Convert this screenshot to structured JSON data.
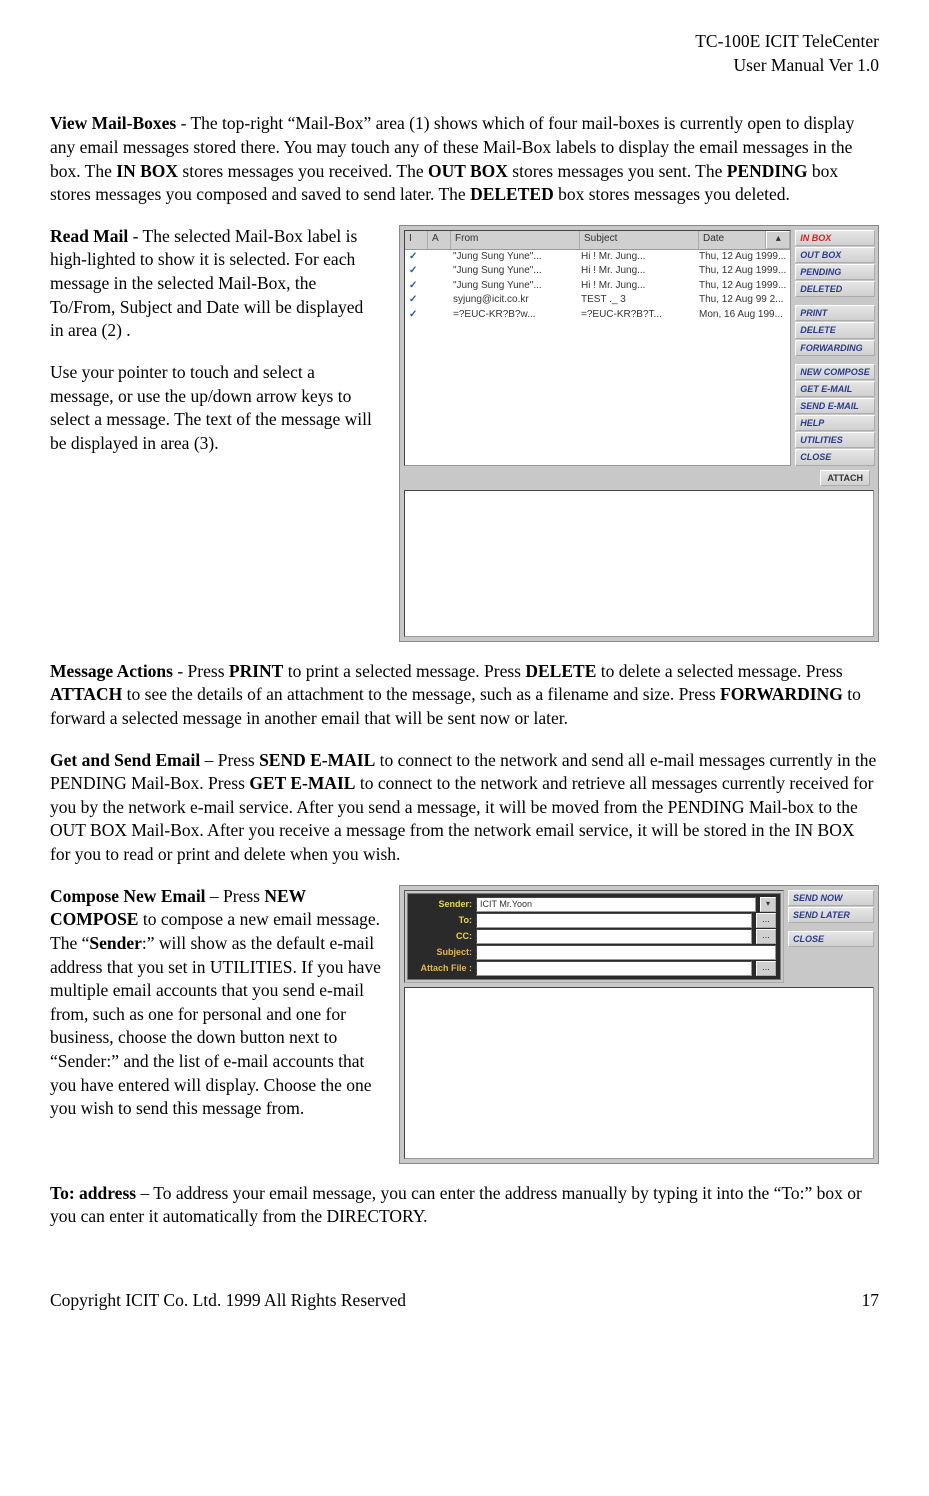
{
  "header": {
    "line1": "TC-100E ICIT TeleCenter",
    "line2": "User Manual  Ver 1.0"
  },
  "para_viewmail": {
    "lead_bold": "View Mail-Boxes ",
    "t1": "- The top-right “Mail-Box” area (1) shows which of four mail-boxes is currently open to display any email messages stored there. You may touch any of these Mail-Box labels to display the email messages in the box. The ",
    "b1": "IN BOX",
    "t2": " stores messages you received. The ",
    "b2": "OUT BOX",
    "t3": " stores messages you sent. The ",
    "b3": "PENDING",
    "t4": " box stores messages you composed and saved to send later. The ",
    "b4": "DELETED",
    "t5": " box stores messages you deleted."
  },
  "para_readmail": {
    "lead_bold": "Read Mail ",
    "t1": "- The selected Mail-Box label is high-lighted to show it is selected. For each message in the selected Mail-Box, the To/From, Subject and Date will be displayed in area (2) ."
  },
  "para_readmail2": "Use your pointer to touch and select a message, or use the up/down arrow keys to select a message. The text of the message will be displayed in area (3).",
  "para_actions": {
    "lead_bold": "Message Actions ",
    "t1": "- Press ",
    "b1": "PRINT",
    "t2": " to print a selected message. Press ",
    "b2": "DELETE",
    "t3": " to delete a selected message. Press ",
    "b3": "ATTACH",
    "t4": " to see the details of an attachment to the message, such as a filename and size. Press ",
    "b4": "FORWARDING",
    "t5": " to forward a selected message in another email that will be sent now or later."
  },
  "para_getsend": {
    "lead_bold": "Get and Send Email ",
    "t1": "– Press ",
    "b1": "SEND E-MAIL",
    "t2": " to connect to the network and send all e-mail messages currently in the PENDING Mail-Box. Press ",
    "b2": "GET E-MAIL",
    "t3": " to connect to the network and retrieve all messages currently received for you by the network e-mail service.  After you send a message, it will be moved from the PENDING Mail-box to the OUT BOX Mail-Box. After you receive a message from the network email service, it will be stored in the IN BOX for you to read or print and delete when you wish."
  },
  "para_compose": {
    "lead_bold": "Compose New Email",
    "dash": " –  Press ",
    "b1": "NEW COMPOSE ",
    "t1": "to compose a new email message.  The “",
    "b2": "Sender",
    "t2": ":” will show as the default e-mail address that you set in UTILITIES. If you have multiple email accounts that you send e-mail from, such as one for personal and one for business, choose the down button next to “Sender:” and the list of e-mail accounts that you have entered will display. Choose the one you wish to send this message from."
  },
  "para_to": {
    "lead_bold": "To:  address",
    "dash": " – ",
    "t1": "To address your email message, you can enter the address manually by typing it into the “To:”  box or you can enter it automatically from the DIRECTORY."
  },
  "footer": {
    "left": "Copyright ICIT Co. Ltd. 1999  All Rights Reserved",
    "right": "17"
  },
  "shot1": {
    "cols": {
      "i": "I",
      "a": "A",
      "from": "From",
      "subject": "Subject",
      "date": "Date"
    },
    "rows": [
      {
        "from": "\"Jung Sung Yune\"...",
        "subj": "Hi ! Mr. Jung...",
        "date": "Thu, 12 Aug 1999..."
      },
      {
        "from": "\"Jung Sung Yune\"...",
        "subj": "Hi ! Mr. Jung...",
        "date": "Thu, 12 Aug 1999..."
      },
      {
        "from": "\"Jung Sung Yune\"...",
        "subj": "Hi ! Mr. Jung...",
        "date": "Thu, 12 Aug 1999..."
      },
      {
        "from": "syjung@icit.co.kr",
        "subj": "TEST ._ 3",
        "date": "Thu, 12 Aug 99 2..."
      },
      {
        "from": "=?EUC-KR?B?w...",
        "subj": "=?EUC-KR?B?T...",
        "date": "Mon, 16 Aug 199..."
      }
    ],
    "attach_btn": "ATTACH",
    "sidebar": {
      "boxes": [
        "IN BOX",
        "OUT BOX",
        "PENDING",
        "DELETED"
      ],
      "group2": [
        "PRINT",
        "DELETE",
        "FORWARDING"
      ],
      "group3": [
        "NEW COMPOSE",
        "GET E-MAIL",
        "SEND E-MAIL",
        "HELP",
        "UTILITIES",
        "CLOSE"
      ]
    }
  },
  "shot2": {
    "labels": {
      "sender": "Sender:",
      "to": "To:",
      "cc": "CC:",
      "subject": "Subject:",
      "attach": "Attach File :"
    },
    "sender_value": "ICIT Mr.Yoon",
    "ellipsis": "...",
    "sidebar": [
      "SEND NOW",
      "SEND LATER",
      "",
      "CLOSE"
    ]
  }
}
